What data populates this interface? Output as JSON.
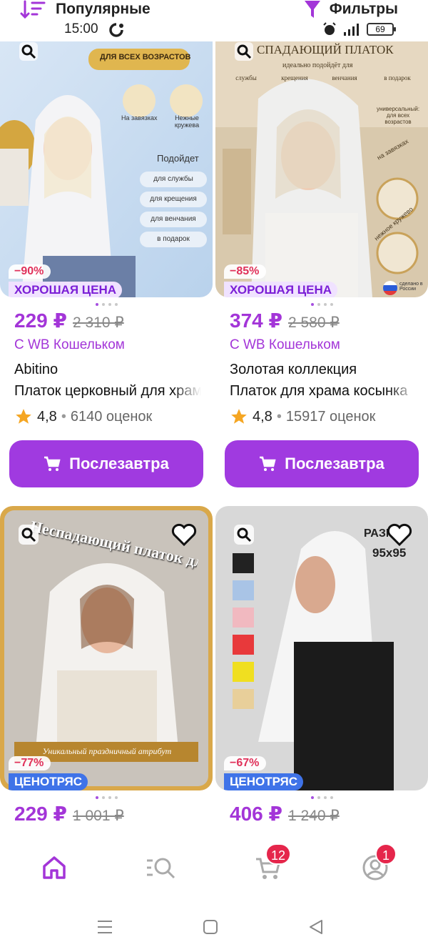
{
  "topbar": {
    "sort_label": "Популярные",
    "filter_label": "Фильтры",
    "time": "15:00",
    "battery": "69"
  },
  "colors": {
    "accent": "#a335d8",
    "buy_button": "#a03ae0",
    "discount": "#e0315a",
    "sale_tag": "#3f73e8",
    "counter": "#e5264b"
  },
  "products": [
    {
      "discount": "−90%",
      "tag": "ХОРОШАЯ ЦЕНА",
      "price": "229 ₽",
      "old_price": "2 310 ₽",
      "wallet": "С WB Кошельком",
      "brand": "Abitino",
      "title": "Платок церковный для храма",
      "rating": "4,8",
      "reviews": "6140 оценок",
      "button": "Послезавтра",
      "image_texts": {
        "for_all_ages": "ДЛЯ ВСЕХ ВОЗРАСТОВ",
        "ties": "На завязках",
        "lace": "Нежные кружева",
        "suits": "Подойдет",
        "opt1": "для службы",
        "opt2": "для крещения",
        "opt3": "для венчания",
        "opt4": "в подарок"
      }
    },
    {
      "discount": "−85%",
      "tag": "ХОРОШАЯ ЦЕНА",
      "price": "374 ₽",
      "old_price": "2 580 ₽",
      "wallet": "С WB Кошельком",
      "brand": "Золотая коллекция",
      "title": "Платок для храма косынка",
      "rating": "4,8",
      "reviews": "15917 оценок",
      "button": "Послезавтра",
      "image_texts": {
        "headline": "СПАДАЮЩИЙ ПЛАТОК",
        "sub": "идеально подойдёт для",
        "opt1": "службы",
        "opt2": "крещения",
        "opt3": "венчания",
        "opt4": "в подарок",
        "universal": "универсальный: для всех возрастов",
        "ties": "на завязках",
        "lace": "нежное кружево",
        "made_in": "сделано в России"
      }
    },
    {
      "discount": "−77%",
      "tag": "ЦЕНОТРЯС",
      "price": "229 ₽",
      "old_price": "1 001 ₽",
      "image_texts": {
        "arc": "Неспадающий платок для храма",
        "footer": "Уникальный праздничный атрибут"
      }
    },
    {
      "discount": "−67%",
      "tag": "ЦЕНОТРЯС",
      "price": "406 ₽",
      "old_price": "1 240 ₽",
      "image_texts": {
        "size_label": "РАЗМЕР",
        "size": "95x95"
      }
    }
  ],
  "nav": {
    "cart_count": "12",
    "profile_count": "1"
  }
}
